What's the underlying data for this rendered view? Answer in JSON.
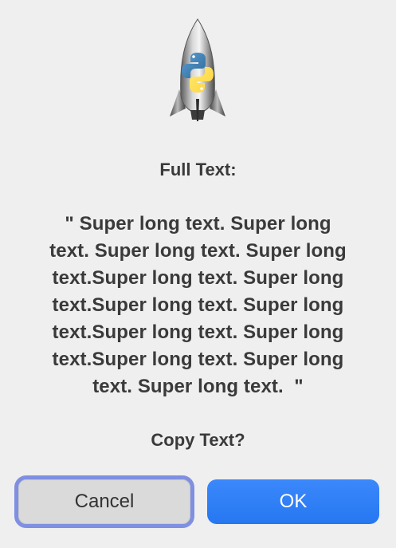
{
  "dialog": {
    "title": "Full Text:",
    "message": "\" Super long text. Super long text. Super long text. Super long text.Super long text. Super long text.Super long text. Super long text.Super long text. Super long text.Super long text. Super long text. Super long text.  \"",
    "message_lines": [
      "\" Super long text. Super long",
      "text. Super long text. Super long",
      "text.Super long text. Super long",
      "text.Super long text. Super long",
      "text.Super long text. Super long",
      "text.Super long text. Super long",
      "text. Super long text.  \""
    ],
    "prompt": "Copy Text?",
    "icon": "python-rocket-launcher-icon"
  },
  "buttons": {
    "cancel_label": "Cancel",
    "ok_label": "OK"
  },
  "colors": {
    "background": "#efefef",
    "text": "#3a3a3a",
    "ok_button": "#2f7ff6",
    "cancel_button": "#dadada",
    "focus_ring": "#7f8fe2"
  }
}
